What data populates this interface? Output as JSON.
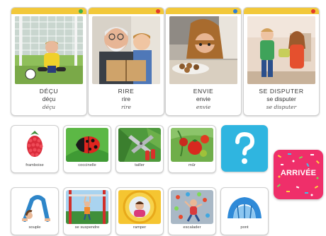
{
  "emotion_cards": [
    {
      "word_caps": "DÉÇU",
      "word_print": "déçu",
      "word_cursive": "déçu",
      "band_color": "#f2c83a",
      "dot_color": "#3db04b"
    },
    {
      "word_caps": "RIRE",
      "word_print": "rire",
      "word_cursive": "rire",
      "band_color": "#f2c83a",
      "dot_color": "#e23b2a"
    },
    {
      "word_caps": "ENVIE",
      "word_print": "envie",
      "word_cursive": "envie",
      "band_color": "#f2c83a",
      "dot_color": "#2f7fd0"
    },
    {
      "word_caps": "SE DISPUTER",
      "word_print": "se disputer",
      "word_cursive": "se disputer",
      "band_color": "#f2c83a",
      "dot_color": "#e23b2a"
    }
  ],
  "row2_cards": [
    {
      "label": "framboise"
    },
    {
      "label": "coccinelle"
    },
    {
      "label": "tailler"
    },
    {
      "label": "mûr"
    }
  ],
  "row3_cards": [
    {
      "label": "souple"
    },
    {
      "label": "se suspendre"
    },
    {
      "label": "ramper"
    },
    {
      "label": "escalader"
    },
    {
      "label": "pont"
    }
  ],
  "question_card": {
    "symbol": "?",
    "color": "#2fb5e0"
  },
  "arrivee_card": {
    "label": "ARRIVÉE",
    "color": "#ef2f6a"
  }
}
